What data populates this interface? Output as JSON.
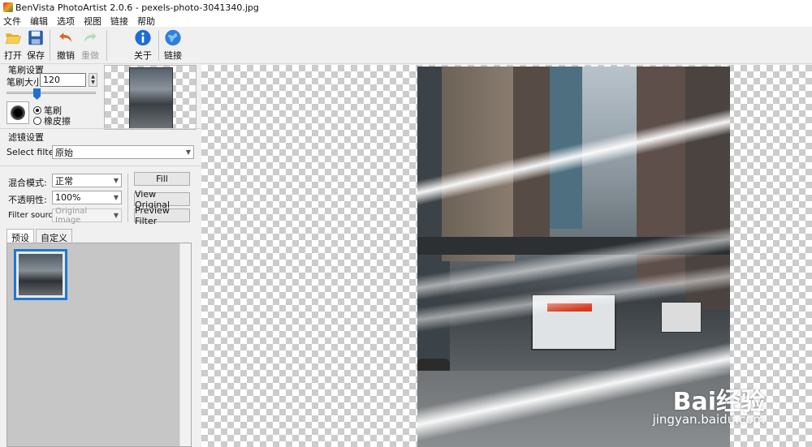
{
  "window": {
    "title": "BenVista PhotoArtist 2.0.6 - pexels-photo-3041340.jpg"
  },
  "menu": [
    "文件",
    "编辑",
    "选项",
    "视图",
    "链接",
    "帮助"
  ],
  "toolbar": {
    "open": {
      "label": "打开",
      "icon": "folder-open-icon"
    },
    "save": {
      "label": "保存",
      "icon": "floppy-disk-icon"
    },
    "undo": {
      "label": "撤销",
      "icon": "undo-arrow-icon"
    },
    "redo": {
      "label": "重做",
      "icon": "redo-arrow-icon",
      "disabled": true
    },
    "about": {
      "label": "关于",
      "icon": "info-icon"
    },
    "link": {
      "label": "链接",
      "icon": "globe-icon"
    }
  },
  "brush": {
    "group_label": "笔刷设置",
    "size_label": "笔刷大小:",
    "size_value": "120",
    "mode_brush": "笔刷",
    "mode_eraser": "橡皮擦",
    "selected_mode": "笔刷"
  },
  "filter": {
    "group_label": "滤镜设置",
    "select_label": "Select filter:",
    "selected": "原始",
    "blend_label": "混合模式:",
    "blend_value": "正常",
    "opacity_label": "不透明性:",
    "opacity_value": "100%",
    "source_label": "Filter source:",
    "source_value": "Original Image",
    "fill_button": "Fill",
    "view_original_button": "View Original",
    "preview_button": "Preview Filter"
  },
  "presets": {
    "tabs": [
      "预设",
      "自定义"
    ],
    "active_tab": 0
  },
  "watermark": {
    "brand": "Bai经验",
    "url": "jingyan.baidu.com"
  },
  "colors": {
    "accent": "#1e78d2",
    "selection": "#1e78d2"
  }
}
